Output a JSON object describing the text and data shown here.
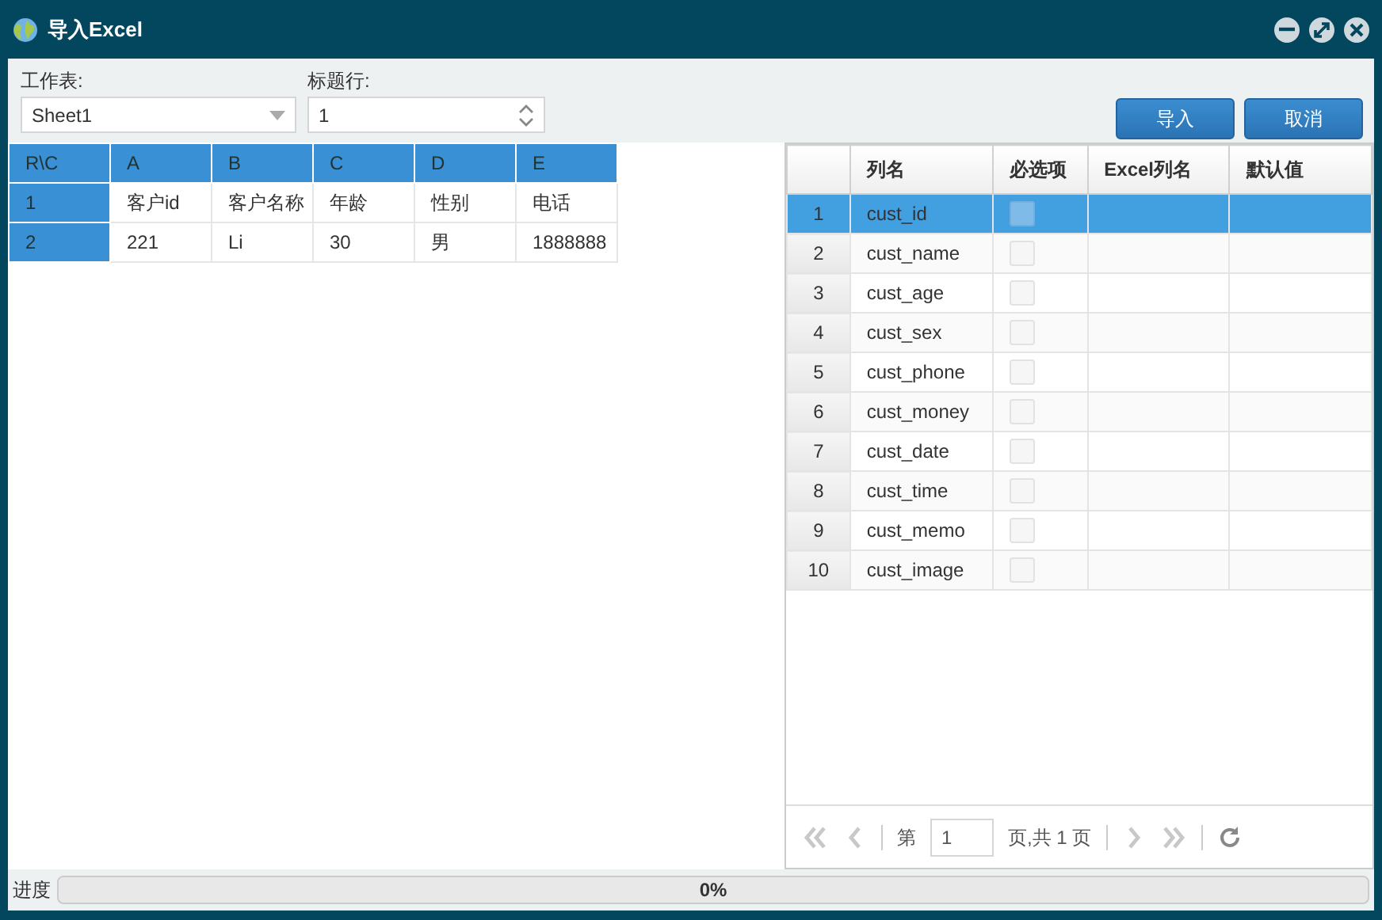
{
  "window": {
    "title": "导入Excel"
  },
  "form": {
    "sheet_label": "工作表:",
    "sheet_value": "Sheet1",
    "header_row_label": "标题行:",
    "header_row_value": "1"
  },
  "buttons": [
    {
      "label": "导入"
    },
    {
      "label": "取消"
    }
  ],
  "sheet_grid": {
    "columns": [
      "R\\C",
      "A",
      "B",
      "C",
      "D",
      "E"
    ],
    "rows": [
      [
        "1",
        "客户id",
        "客户名称",
        "年龄",
        "性别",
        "电话"
      ],
      [
        "2",
        "221",
        "Li",
        "30",
        "男",
        "1888888"
      ]
    ]
  },
  "mapping_grid": {
    "columns": [
      "列名",
      "必选项",
      "Excel列名",
      "默认值"
    ],
    "rows": [
      {
        "number": "1",
        "name": "cust_id",
        "checked": false,
        "selected": true
      },
      {
        "number": "2",
        "name": "cust_name",
        "checked": false,
        "selected": false
      },
      {
        "number": "3",
        "name": "cust_age",
        "checked": false,
        "selected": false
      },
      {
        "number": "4",
        "name": "cust_sex",
        "checked": false,
        "selected": false
      },
      {
        "number": "5",
        "name": "cust_phone",
        "checked": false,
        "selected": false
      },
      {
        "number": "6",
        "name": "cust_money",
        "checked": false,
        "selected": false
      },
      {
        "number": "7",
        "name": "cust_date",
        "checked": false,
        "selected": false
      },
      {
        "number": "8",
        "name": "cust_time",
        "checked": false,
        "selected": false
      },
      {
        "number": "9",
        "name": "cust_memo",
        "checked": false,
        "selected": false
      },
      {
        "number": "10",
        "name": "cust_image",
        "checked": false,
        "selected": false
      }
    ]
  },
  "pager": {
    "before": "第",
    "page": "1",
    "after": "页,共 1 页"
  },
  "progress": {
    "label": "进度",
    "level": 0,
    "reading": "0%"
  }
}
